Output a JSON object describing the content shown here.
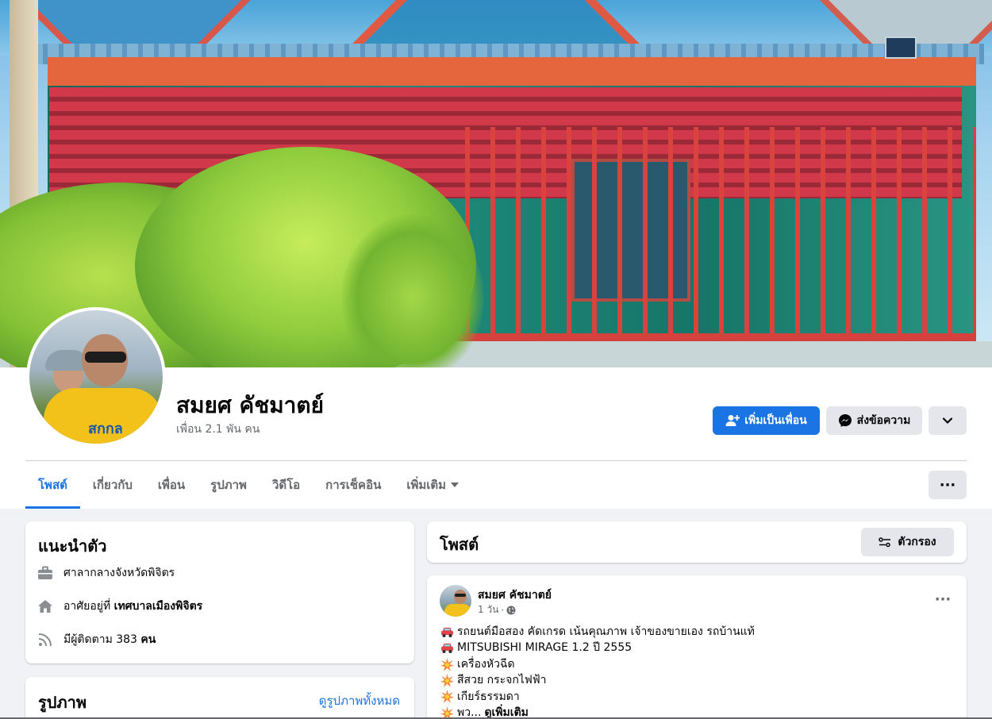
{
  "profile": {
    "name": "สมยศ คัชมาตย์",
    "friends": "เพื่อน 2.1 พัน คน",
    "avatar_shirt_text": "สกกล"
  },
  "actions": {
    "add_friend": "เพิ่มเป็นเพื่อน",
    "message": "ส่งข้อความ",
    "dropdown_icon": "chevron-down-icon"
  },
  "tabs": [
    {
      "label": "โพสต์",
      "active": true
    },
    {
      "label": "เกี่ยวกับ",
      "active": false
    },
    {
      "label": "เพื่อน",
      "active": false
    },
    {
      "label": "รูปภาพ",
      "active": false
    },
    {
      "label": "วิดีโอ",
      "active": false
    },
    {
      "label": "การเช็คอิน",
      "active": false
    },
    {
      "label": "เพิ่มเติม",
      "active": false
    }
  ],
  "intro": {
    "title": "แนะนำตัว",
    "work": "ศาลากลางจังหวัดพิจิตร",
    "lives_prefix": "อาศัยอยู่ที่",
    "lives_place": "เทศบาลเมืองพิจิตร",
    "followers_prefix": "มีผู้ติดตาม 383",
    "followers_suffix": "คน"
  },
  "photos": {
    "title": "รูปภาพ",
    "see_all": "ดูรูปภาพทั้งหมด"
  },
  "posts": {
    "title": "โพสต์",
    "filter": "ตัวกรอง"
  },
  "post": {
    "author": "สมยศ คัชมาตย์",
    "time": "1 วัน",
    "separator": "·",
    "lines": [
      {
        "emoji": "car",
        "text": "รถยนต์มือสอง คัดเกรด เน้นคุณภาพ เจ้าของขายเอง รถบ้านแท้"
      },
      {
        "emoji": "car",
        "text": "MITSUBISHI MIRAGE 1.2 ปี 2555"
      },
      {
        "emoji": "burst",
        "text": "เครื่องหัวฉีด"
      },
      {
        "emoji": "burst",
        "text": "สีสวย กระจกไฟฟ้า"
      },
      {
        "emoji": "burst",
        "text": "เกียร์ธรรมดา"
      },
      {
        "emoji": "burst",
        "text": "พว..."
      }
    ],
    "see_more": "ดูเพิ่มเติม"
  },
  "colors": {
    "accent": "#1b74e4",
    "background": "#f0f2f5",
    "secondary_button": "#e4e6eb"
  }
}
